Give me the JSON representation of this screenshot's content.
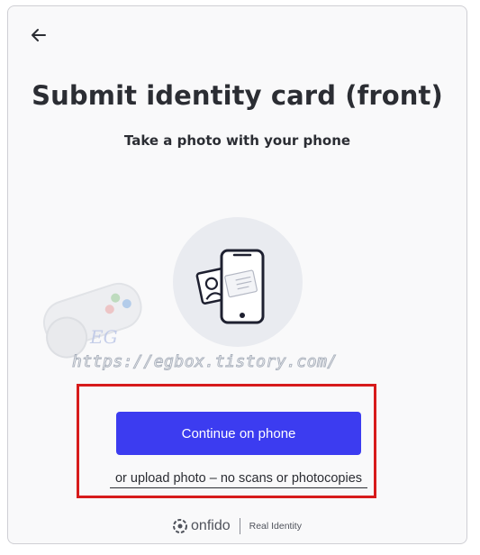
{
  "header": {
    "back_icon": "arrow-left-icon"
  },
  "main": {
    "title": "Submit identity card (front)",
    "subtitle": "Take a photo with your phone",
    "illustration_icon": "phone-with-id-card-icon"
  },
  "actions": {
    "continue_label": "Continue on phone",
    "upload_label": "or upload photo – no scans or photocopies"
  },
  "footer": {
    "brand_name": "onfido",
    "tagline": "Real Identity"
  },
  "watermark": {
    "text": "https://egbox.tistory.com/",
    "mark": "EG"
  },
  "colors": {
    "primary_button": "#3c3cf0",
    "highlight_border": "#d71b1b",
    "text": "#2b2d33",
    "illustration_bg": "#e9ebf0"
  }
}
